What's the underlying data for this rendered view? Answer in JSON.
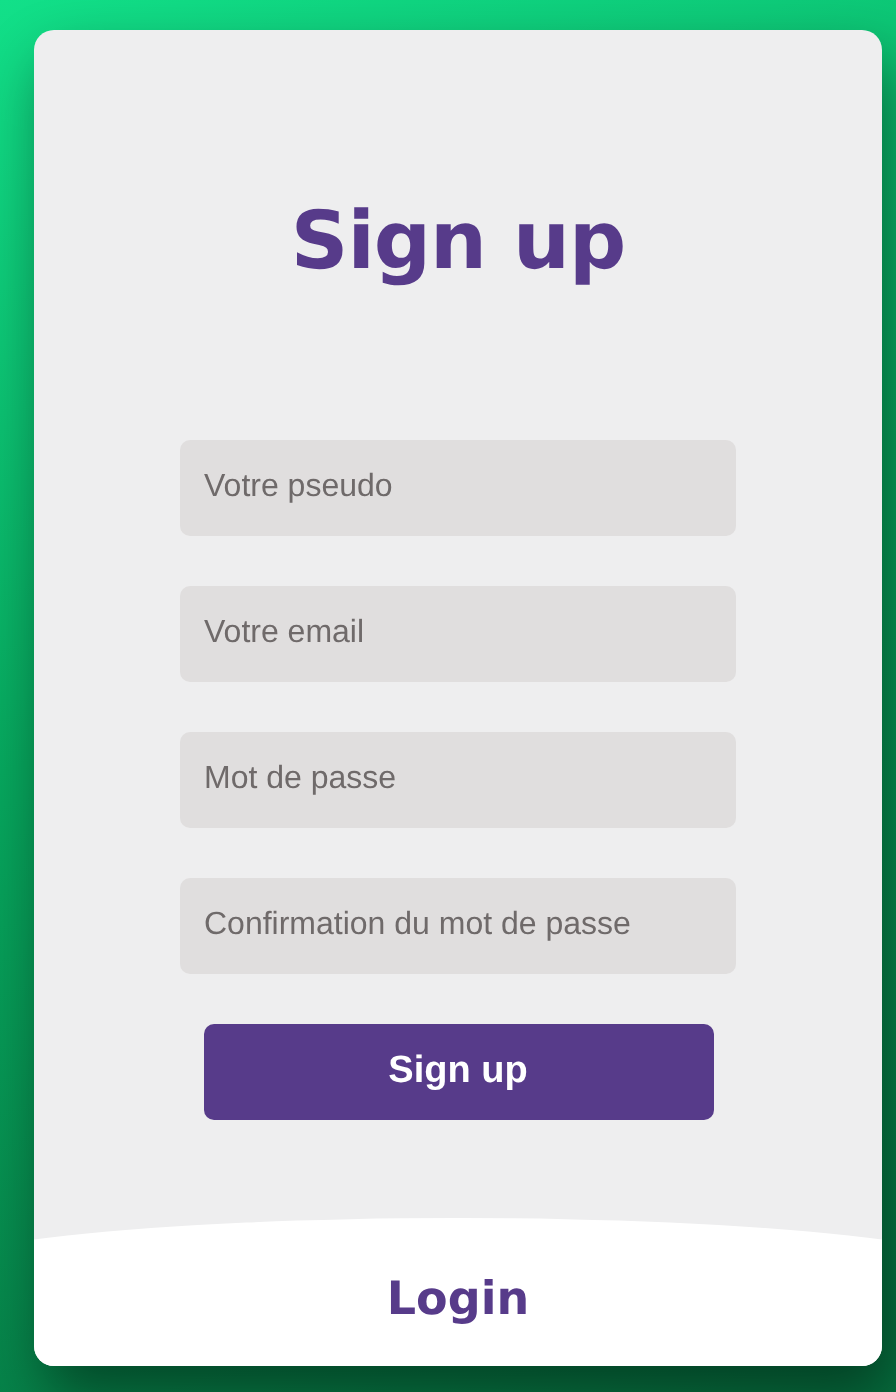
{
  "title": "Sign up",
  "fields": [
    {
      "placeholder": "Votre pseudo"
    },
    {
      "placeholder": "Votre email"
    },
    {
      "placeholder": "Mot de passe"
    },
    {
      "placeholder": "Confirmation du mot de passe"
    }
  ],
  "submit": "Sign up",
  "login": "Login"
}
